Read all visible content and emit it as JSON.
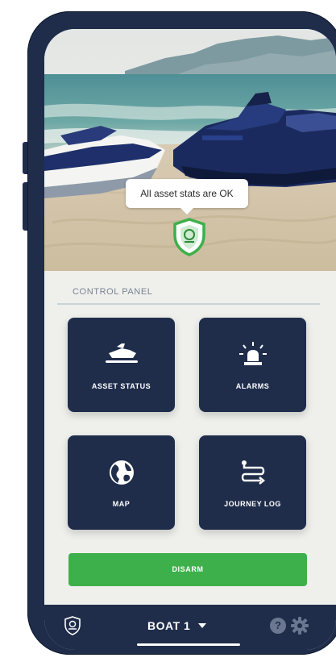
{
  "hero": {
    "status_message": "All asset stats are OK"
  },
  "control_panel": {
    "title": "CONTROL PANEL",
    "tiles": [
      {
        "label": "ASSET STATUS",
        "icon": "jetski-icon"
      },
      {
        "label": "ALARMS",
        "icon": "siren-icon"
      },
      {
        "label": "MAP",
        "icon": "globe-icon"
      },
      {
        "label": "JOURNEY LOG",
        "icon": "route-icon"
      }
    ],
    "disarm_label": "DISARM"
  },
  "bottom_bar": {
    "boat_selector": "BOAT 1",
    "logo_icon": "shield-logo-icon",
    "help_icon": "help-icon",
    "settings_icon": "gear-icon"
  },
  "colors": {
    "navy": "#1f2d4b",
    "green": "#3eb04b",
    "panel_bg": "#eff0ec"
  }
}
